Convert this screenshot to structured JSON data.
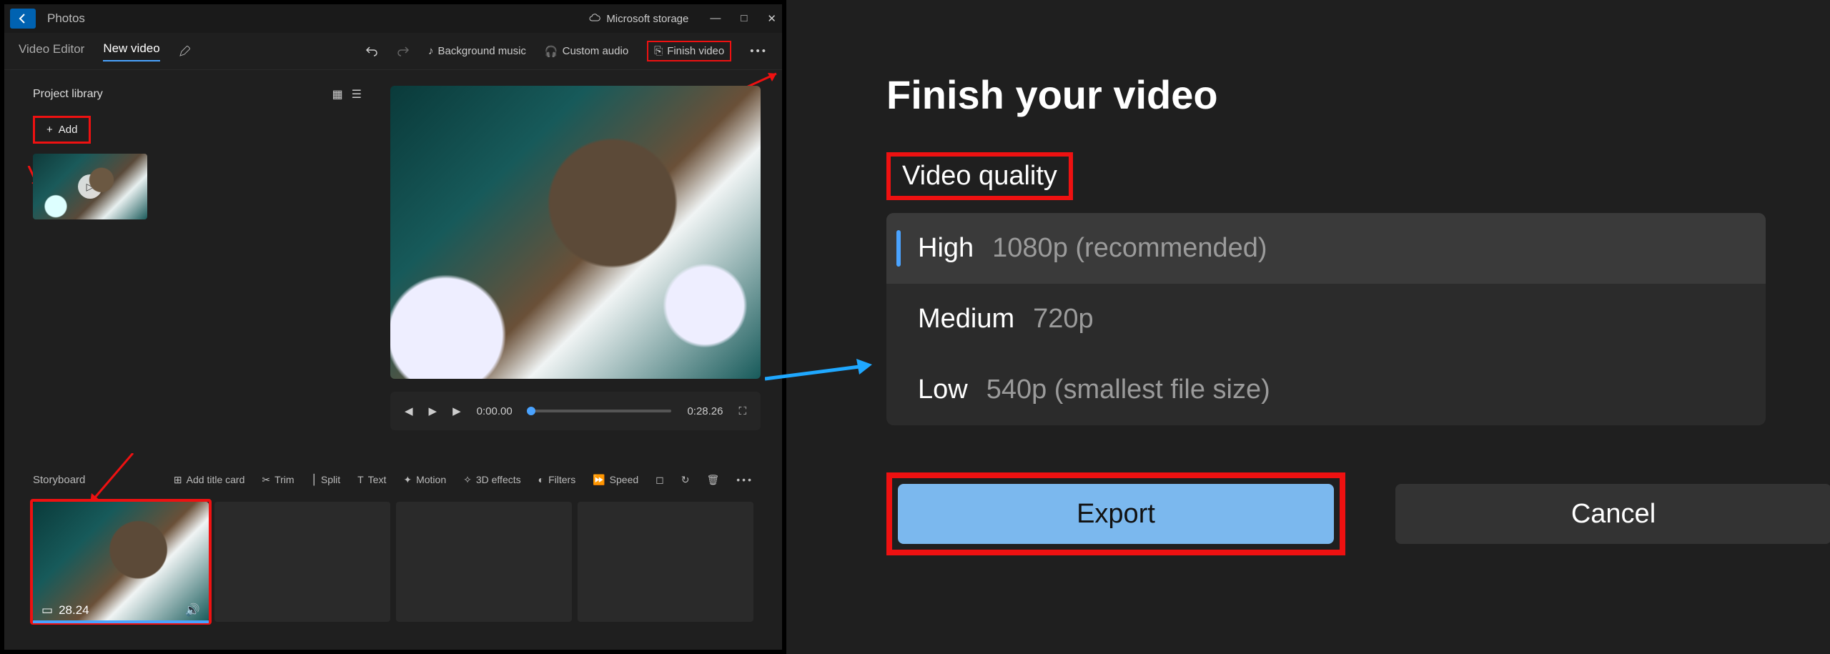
{
  "titlebar": {
    "app": "Photos",
    "storage": "Microsoft storage"
  },
  "tabs": {
    "videoEditor": "Video Editor",
    "newVideo": "New video"
  },
  "toolbar": {
    "bgMusic": "Background music",
    "customAudio": "Custom audio",
    "finishVideo": "Finish video"
  },
  "library": {
    "title": "Project library",
    "add": "Add"
  },
  "player": {
    "cur": "0:00.00",
    "total": "0:28.26"
  },
  "storyboard": {
    "label": "Storyboard",
    "addTitle": "Add title card",
    "trim": "Trim",
    "split": "Split",
    "text": "Text",
    "motion": "Motion",
    "effects3d": "3D effects",
    "filters": "Filters",
    "speed": "Speed"
  },
  "clip": {
    "duration": "28.24"
  },
  "dialog": {
    "title": "Finish your video",
    "qualityLabel": "Video quality",
    "options": [
      {
        "name": "High",
        "detail": "1080p (recommended)"
      },
      {
        "name": "Medium",
        "detail": "720p"
      },
      {
        "name": "Low",
        "detail": "540p (smallest file size)"
      }
    ],
    "export": "Export",
    "cancel": "Cancel"
  }
}
